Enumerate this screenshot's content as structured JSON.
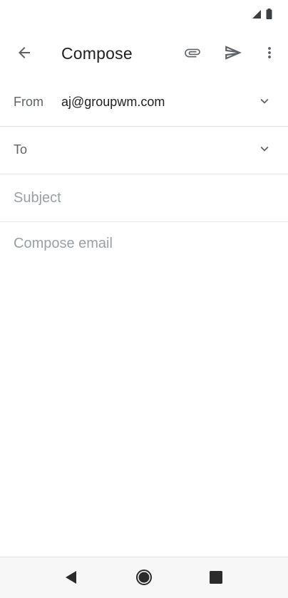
{
  "status_bar": {
    "icons": [
      "signal-icon",
      "battery-icon"
    ]
  },
  "app_bar": {
    "title": "Compose",
    "back_icon": "arrow-back-icon",
    "attach_icon": "paperclip-icon",
    "send_icon": "send-icon",
    "more_icon": "more-vert-icon"
  },
  "fields": {
    "from_label": "From",
    "from_value": "aj@groupwm.com",
    "to_label": "To",
    "subject_placeholder": "Subject"
  },
  "body": {
    "placeholder": "Compose email"
  },
  "nav_bar": {
    "icons": [
      "nav-back-icon",
      "nav-home-icon",
      "nav-recents-icon"
    ]
  },
  "colors": {
    "text_primary": "#202124",
    "text_secondary": "#5f6368",
    "placeholder": "#9aa0a6",
    "divider": "#e6e6e6",
    "icon": "#5f6368"
  }
}
